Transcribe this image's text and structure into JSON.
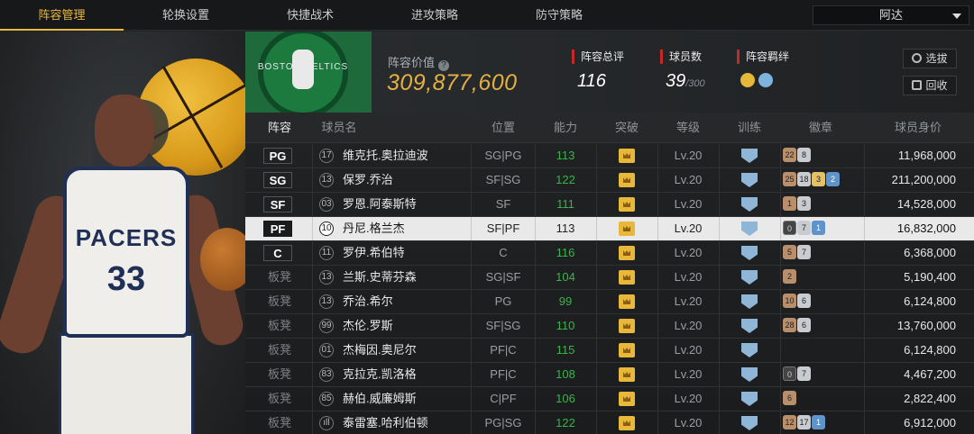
{
  "tabs": [
    {
      "label": "阵容管理",
      "active": true
    },
    {
      "label": "轮换设置",
      "active": false
    },
    {
      "label": "快捷战术",
      "active": false
    },
    {
      "label": "进攻策略",
      "active": false
    },
    {
      "label": "防守策略",
      "active": false
    }
  ],
  "team_select": {
    "value": "阿达"
  },
  "header": {
    "emblem_text": "BOSTON CELTICS",
    "value_label": "阵容价值",
    "value": "309,877,600",
    "overall_label": "阵容总评",
    "overall": "116",
    "count_label": "球员数",
    "count": "39",
    "count_max": "/300",
    "bond_label": "阵容羁绊",
    "select_btn": "选拔",
    "recycle_btn": "回收"
  },
  "hero": {
    "team_name": "PACERS",
    "number": "33"
  },
  "columns": [
    "阵容",
    "球员名",
    "位置",
    "能力",
    "突破",
    "等级",
    "训练",
    "徽章",
    "球员身价"
  ],
  "rows": [
    {
      "slot": "PG",
      "starter": true,
      "selected": false,
      "num": "17",
      "name": "维克托.奥拉迪波",
      "pos": "SG|PG",
      "ability": "113",
      "level": "Lv.20",
      "badges": [
        {
          "t": "b",
          "v": "22"
        },
        {
          "t": "s",
          "v": "8"
        }
      ],
      "salary": "11,968,000"
    },
    {
      "slot": "SG",
      "starter": true,
      "selected": false,
      "num": "13",
      "name": "保罗.乔治",
      "pos": "SF|SG",
      "ability": "122",
      "level": "Lv.20",
      "badges": [
        {
          "t": "b",
          "v": "25"
        },
        {
          "t": "s",
          "v": "18"
        },
        {
          "t": "g",
          "v": "3"
        },
        {
          "t": "p",
          "v": "2"
        }
      ],
      "salary": "211,200,000"
    },
    {
      "slot": "SF",
      "starter": true,
      "selected": false,
      "num": "03",
      "name": "罗恩.阿泰斯特",
      "pos": "SF",
      "ability": "111",
      "level": "Lv.20",
      "badges": [
        {
          "t": "b",
          "v": "1"
        },
        {
          "t": "s",
          "v": "3"
        }
      ],
      "salary": "14,528,000"
    },
    {
      "slot": "PF",
      "starter": true,
      "selected": true,
      "num": "10",
      "name": "丹尼.格兰杰",
      "pos": "SF|PF",
      "ability": "113",
      "level": "Lv.20",
      "badges": [
        {
          "t": "d",
          "v": "0"
        },
        {
          "t": "s",
          "v": "7"
        },
        {
          "t": "p",
          "v": "1"
        }
      ],
      "salary": "16,832,000"
    },
    {
      "slot": "C",
      "starter": true,
      "selected": false,
      "num": "11",
      "name": "罗伊.希伯特",
      "pos": "C",
      "ability": "116",
      "level": "Lv.20",
      "badges": [
        {
          "t": "b",
          "v": "5"
        },
        {
          "t": "s",
          "v": "7"
        }
      ],
      "salary": "6,368,000"
    },
    {
      "slot": "板凳",
      "starter": false,
      "selected": false,
      "num": "13",
      "name": "兰斯.史蒂芬森",
      "pos": "SG|SF",
      "ability": "104",
      "level": "Lv.20",
      "badges": [
        {
          "t": "b",
          "v": "2"
        }
      ],
      "salary": "5,190,400"
    },
    {
      "slot": "板凳",
      "starter": false,
      "selected": false,
      "num": "13",
      "name": "乔治.希尔",
      "pos": "PG",
      "ability": "99",
      "level": "Lv.20",
      "badges": [
        {
          "t": "b",
          "v": "10"
        },
        {
          "t": "s",
          "v": "6"
        }
      ],
      "salary": "6,124,800"
    },
    {
      "slot": "板凳",
      "starter": false,
      "selected": false,
      "num": "99",
      "name": "杰伦.罗斯",
      "pos": "SF|SG",
      "ability": "110",
      "level": "Lv.20",
      "badges": [
        {
          "t": "b",
          "v": "28"
        },
        {
          "t": "s",
          "v": "6"
        }
      ],
      "salary": "13,760,000"
    },
    {
      "slot": "板凳",
      "starter": false,
      "selected": false,
      "num": "01",
      "name": "杰梅因.奥尼尔",
      "pos": "PF|C",
      "ability": "115",
      "level": "Lv.20",
      "badges": [],
      "salary": "6,124,800"
    },
    {
      "slot": "板凳",
      "starter": false,
      "selected": false,
      "num": "83",
      "name": "克拉克.凯洛格",
      "pos": "PF|C",
      "ability": "108",
      "level": "Lv.20",
      "badges": [
        {
          "t": "d",
          "v": "0"
        },
        {
          "t": "s",
          "v": "7"
        }
      ],
      "salary": "4,467,200"
    },
    {
      "slot": "板凳",
      "starter": false,
      "selected": false,
      "num": "85",
      "name": "赫伯.威廉姆斯",
      "pos": "C|PF",
      "ability": "106",
      "level": "Lv.20",
      "badges": [
        {
          "t": "b",
          "v": "6"
        }
      ],
      "salary": "2,822,400"
    },
    {
      "slot": "板凳",
      "starter": false,
      "selected": false,
      "num": "ıll",
      "name": "泰雷塞.哈利伯顿",
      "pos": "PG|SG",
      "ability": "122",
      "level": "Lv.20",
      "badges": [
        {
          "t": "b",
          "v": "12"
        },
        {
          "t": "s",
          "v": "17"
        },
        {
          "t": "p",
          "v": "1"
        }
      ],
      "salary": "6,912,000"
    }
  ],
  "colors": {
    "accent": "#e8b840",
    "ability_green": "#3ab34a",
    "stat_red": "#c62828"
  }
}
